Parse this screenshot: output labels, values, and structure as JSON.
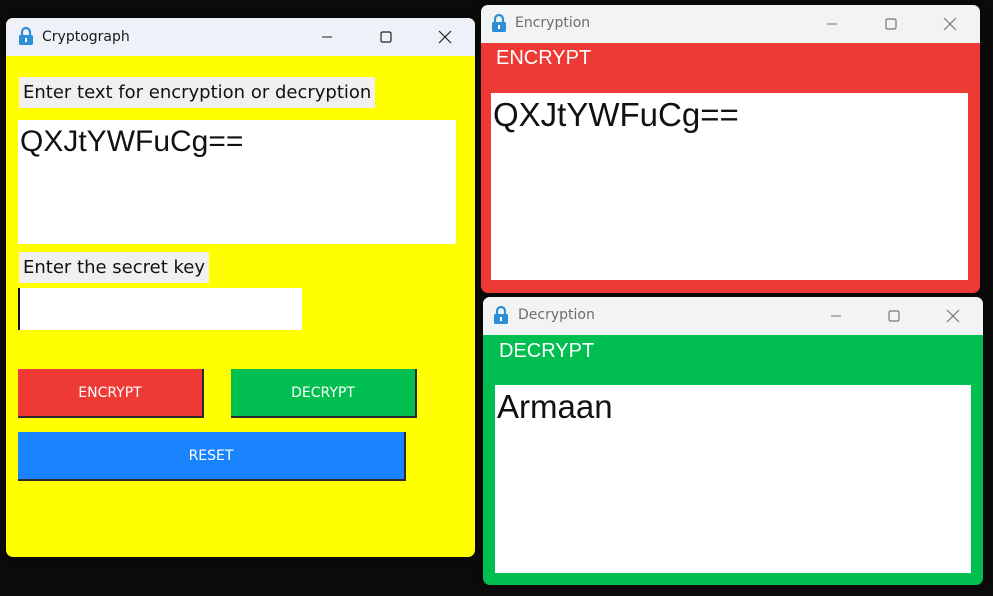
{
  "main_window": {
    "title": "Cryptograph",
    "input_label": "Enter text for encryption or decryption",
    "input_text": "QXJtYWFuCg==",
    "key_label": "Enter the secret key",
    "key_value": "",
    "encrypt_button": "ENCRYPT",
    "decrypt_button": "DECRYPT",
    "reset_button": "RESET",
    "bg_color": "#ffff00",
    "encrypt_color": "#ee3a34",
    "decrypt_color": "#00bf50",
    "reset_color": "#1a84ff"
  },
  "encryption_window": {
    "title": "Encryption",
    "header": "ENCRYPT",
    "output": "QXJtYWFuCg==",
    "bg_color": "#ee3a34"
  },
  "decryption_window": {
    "title": "Decryption",
    "header": "DECRYPT",
    "output": "Armaan",
    "bg_color": "#00bf50"
  },
  "window_controls": {
    "icons": [
      "lock-icon",
      "minimize-icon",
      "maximize-icon",
      "close-icon"
    ]
  }
}
